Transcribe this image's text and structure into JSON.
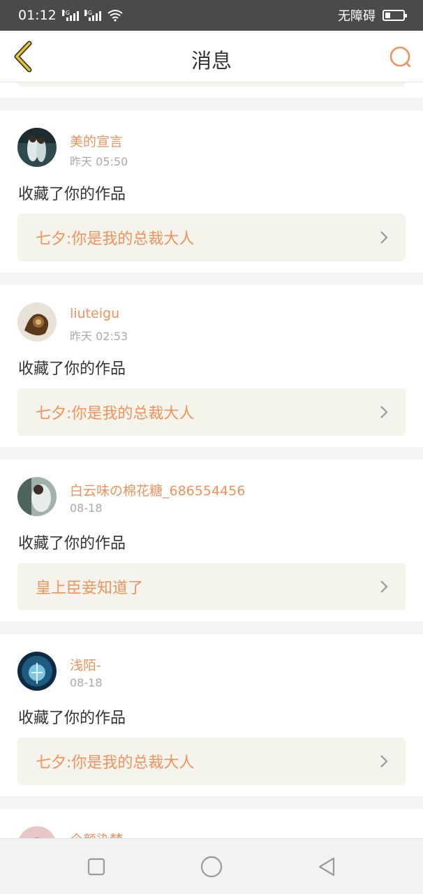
{
  "status_bar": {
    "time": "01:12",
    "signal_1_label": "2G",
    "signal_2_label": "4G",
    "accessibility_label": "无障碍",
    "battery_level": 0.3
  },
  "header": {
    "title": "消息"
  },
  "notifications": [
    {
      "username": "美的宣言",
      "time": "昨天 05:50",
      "action": "收藏了你的作品",
      "work_title": "七夕:你是我的总裁大人",
      "avatar": "avatar-1"
    },
    {
      "username": "liuteigu",
      "time": "昨天 02:53",
      "action": "收藏了你的作品",
      "work_title": "七夕:你是我的总裁大人",
      "avatar": "avatar-2"
    },
    {
      "username": "白云味の棉花糖_686554456",
      "time": "08-18",
      "action": "收藏了你的作品",
      "work_title": "皇上臣妾知道了",
      "avatar": "avatar-3"
    },
    {
      "username": "浅陌-",
      "time": "08-18",
      "action": "收藏了你的作品",
      "work_title": "七夕:你是我的总裁大人",
      "avatar": "avatar-4"
    },
    {
      "username": "仐颜染梦",
      "time": "",
      "action": "",
      "work_title": "",
      "avatar": "avatar-5"
    }
  ],
  "colors": {
    "accent": "#f0925a",
    "back_arrow": "#e8c52a",
    "link_bg": "#f4f4ec"
  },
  "icons": {
    "back": "back-arrow-icon",
    "search": "search-icon",
    "chevron": "chevron-right-icon",
    "nav_recent": "square-icon",
    "nav_home": "circle-icon",
    "nav_back": "triangle-back-icon"
  }
}
